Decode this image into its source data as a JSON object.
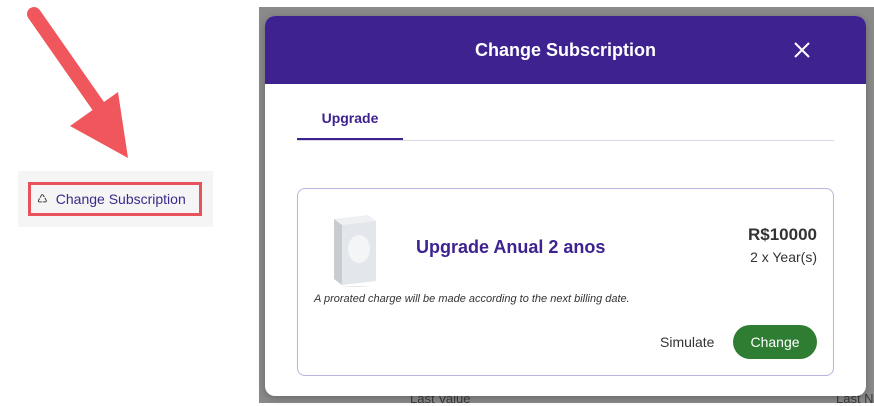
{
  "annotation": {
    "menu_item_label": "Change Subscription",
    "menu_item_icon": "recycle-icon",
    "highlight_color": "#e8525a",
    "arrow_color": "#f0575d"
  },
  "background_page": {
    "fragments": [
      "Last Value",
      "Last N"
    ]
  },
  "modal": {
    "title": "Change Subscription",
    "header_color": "#3d2290",
    "tabs": [
      {
        "label": "Upgrade",
        "active": true
      }
    ],
    "plan": {
      "name": "Upgrade Anual 2 anos",
      "price": "R$10000",
      "period": "2 x Year(s)",
      "note": "A prorated charge will be made according to the next billing date.",
      "simulate_label": "Simulate",
      "change_label": "Change",
      "change_color": "#2e7d32"
    }
  }
}
